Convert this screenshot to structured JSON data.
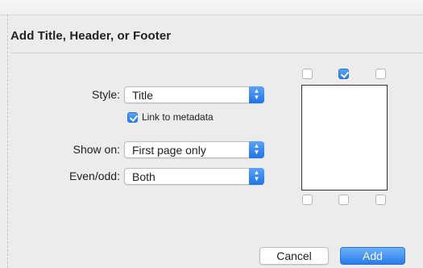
{
  "dialog": {
    "title": "Add Title, Header, or Footer"
  },
  "form": {
    "style_label": "Style:",
    "style_value": "Title",
    "link_label": "Link to metadata",
    "link_checked": true,
    "show_on_label": "Show on:",
    "show_on_value": "First page only",
    "even_odd_label": "Even/odd:",
    "even_odd_value": "Both"
  },
  "position_grid": {
    "top_checks": [
      false,
      true,
      false
    ],
    "bottom_checks": [
      false,
      false,
      false
    ]
  },
  "buttons": {
    "cancel_label": "Cancel",
    "add_label": "Add"
  },
  "colors": {
    "accent": "#2a7be9",
    "background": "#ececec"
  }
}
